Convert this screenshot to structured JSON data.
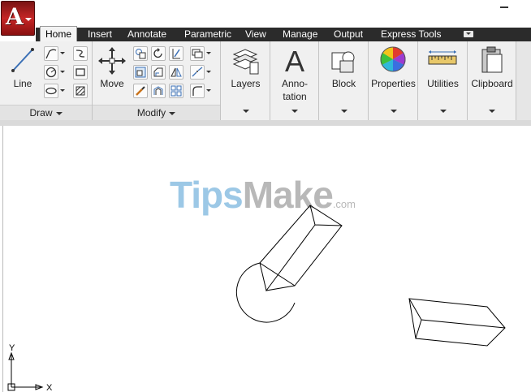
{
  "app": {
    "logo_letter": "A",
    "menu_icon": "autocad-logo-icon"
  },
  "tabs": [
    "Home",
    "Insert",
    "Annotate",
    "Parametric",
    "View",
    "Manage",
    "Output",
    "Express Tools"
  ],
  "panels": {
    "draw": {
      "footer": "Draw",
      "line_label": "Line"
    },
    "modify": {
      "footer": "Modify",
      "move_label": "Move"
    },
    "layers": {
      "label": "Layers"
    },
    "annotation": {
      "glyph": "A",
      "label_line1": "Anno-",
      "label_line2": "tation"
    },
    "block": {
      "label": "Block"
    },
    "properties": {
      "label": "Properties"
    },
    "utilities": {
      "label": "Utilities"
    },
    "clipboard": {
      "label": "Clipboard"
    }
  },
  "watermark": {
    "part1": "Tips",
    "part2": "Make",
    "part3": ".com"
  },
  "ucs": {
    "x_label": "X",
    "y_label": "Y"
  },
  "colors": {
    "tab_bar": "#2b2b2b",
    "ribbon": "#f0f0f0",
    "app_button": "#c62626",
    "watermark_blue": "#9cc8e6"
  }
}
